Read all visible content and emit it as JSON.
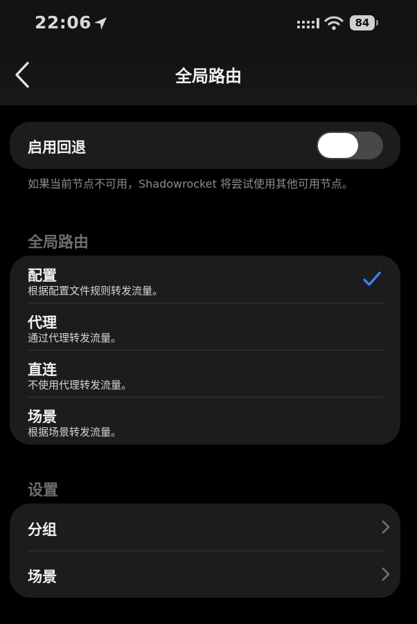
{
  "status_bar": {
    "time": "22:06",
    "battery": "84",
    "icons": [
      "location-arrow-icon",
      "cellular-signal-icon",
      "wifi-icon",
      "battery-icon"
    ]
  },
  "nav": {
    "title": "全局路由",
    "back_icon": "chevron-left-icon"
  },
  "fallback": {
    "label": "启用回退",
    "toggle_on": false,
    "footnote": "如果当前节点不可用，Shadowrocket 将尝试使用其他可用节点。"
  },
  "routing": {
    "header": "全局路由",
    "options": [
      {
        "title": "配置",
        "subtitle": "根据配置文件规则转发流量。",
        "selected": true
      },
      {
        "title": "代理",
        "subtitle": "通过代理转发流量。",
        "selected": false
      },
      {
        "title": "直连",
        "subtitle": "不使用代理转发流量。",
        "selected": false
      },
      {
        "title": "场景",
        "subtitle": "根据场景转发流量。",
        "selected": false
      }
    ]
  },
  "settings": {
    "header": "设置",
    "items": [
      {
        "label": "分组"
      },
      {
        "label": "场景"
      }
    ]
  },
  "colors": {
    "accent": "#3a82f7",
    "card": "#1c1c1e",
    "background": "#000000"
  }
}
